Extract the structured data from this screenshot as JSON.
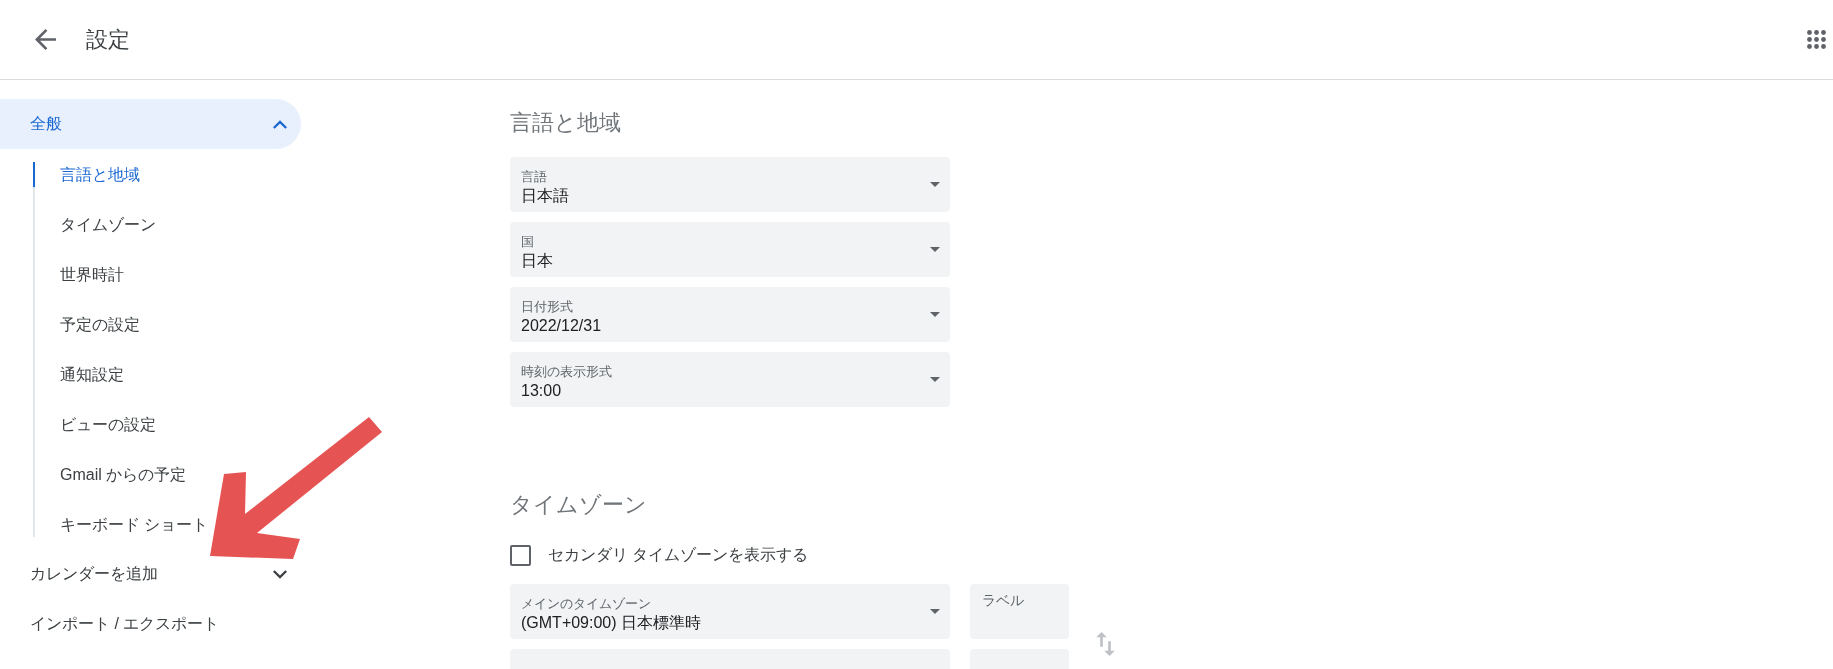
{
  "app_bar": {
    "title": "設定"
  },
  "sidebar": [
    {
      "label": "全般",
      "selected": true,
      "expanded": true,
      "children": [
        {
          "label": "言語と地域",
          "selected": true
        },
        {
          "label": "タイムゾーン",
          "selected": false
        },
        {
          "label": "世界時計",
          "selected": false
        },
        {
          "label": "予定の設定",
          "selected": false
        },
        {
          "label": "通知設定",
          "selected": false
        },
        {
          "label": "ビューの設定",
          "selected": false
        },
        {
          "label": "Gmail からの予定",
          "selected": false
        },
        {
          "label": "キーボード ショート",
          "selected": false
        }
      ]
    },
    {
      "label": "カレンダーを追加",
      "selected": false,
      "expanded": false
    },
    {
      "label": "インポート / エクスポート",
      "selected": false
    }
  ],
  "sections": [
    {
      "title": "言語と地域",
      "fields": [
        {
          "label": "言語",
          "value": "日本語"
        },
        {
          "label": "国",
          "value": "日本"
        },
        {
          "label": "日付形式",
          "value": "2022/12/31"
        },
        {
          "label": "時刻の表示形式",
          "value": "13:00"
        }
      ]
    },
    {
      "title": "タイムゾーン",
      "checkbox": {
        "label": "セカンダリ タイムゾーンを表示する",
        "checked": false
      },
      "timezones": [
        {
          "kind": "select_with_label",
          "label": "メインのタイムゾーン",
          "value": "(GMT+09:00) 日本標準時",
          "label_field": {
            "placeholder": "ラベル"
          }
        },
        {
          "kind": "select_with_label"
        }
      ]
    }
  ]
}
